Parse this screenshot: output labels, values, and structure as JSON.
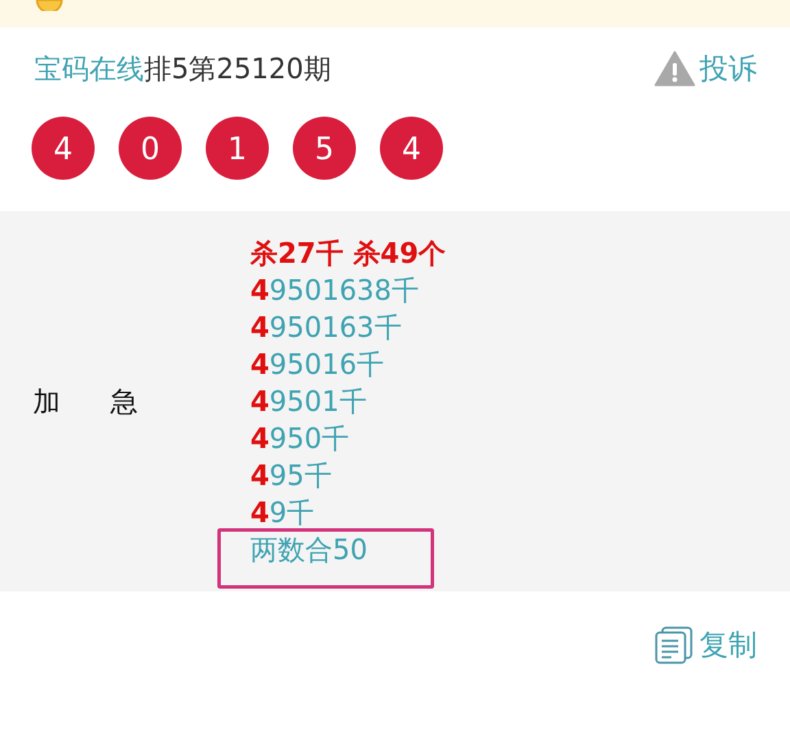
{
  "title": {
    "source": "宝码在线",
    "issue": "排5第25120期"
  },
  "report": {
    "label": "投诉"
  },
  "balls": [
    "4",
    "0",
    "1",
    "5",
    "4"
  ],
  "panel": {
    "label": "加 急",
    "lines": [
      {
        "kind": "headline",
        "text": "杀27千 杀49个"
      },
      {
        "kind": "entry",
        "text": "**4**9501638千"
      },
      {
        "kind": "entry",
        "text": "**4**950163千"
      },
      {
        "kind": "entry",
        "text": "**4**95016千"
      },
      {
        "kind": "entry",
        "text": "**4**9501千"
      },
      {
        "kind": "entry",
        "text": "**4**950千"
      },
      {
        "kind": "entry",
        "text": "**4**95千"
      },
      {
        "kind": "entry",
        "text": "**4**9千"
      },
      {
        "kind": "entry",
        "text": "两数合50",
        "highlighted": true
      }
    ]
  },
  "copy": {
    "label": "复制"
  }
}
